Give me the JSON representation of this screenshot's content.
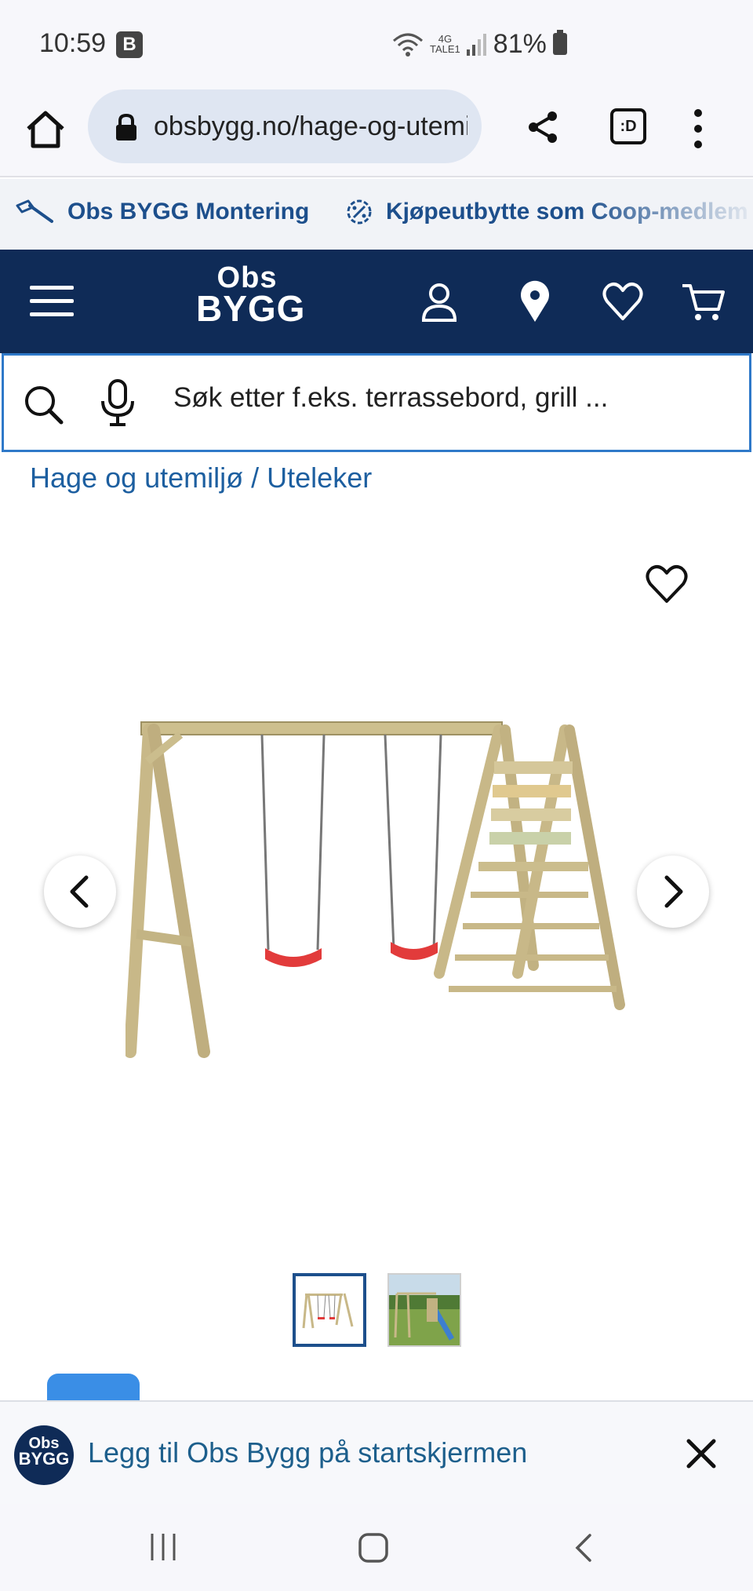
{
  "status_bar": {
    "time": "10:59",
    "badge": "B",
    "network_top": "4G",
    "network_bottom": "TALE1",
    "battery": "81%"
  },
  "browser": {
    "url": "obsbygg.no/hage-og-utemiljo/uteleker"
  },
  "promo_strip": {
    "items": [
      {
        "label": "Obs BYGG Montering",
        "icon": "hammer-icon"
      },
      {
        "label": "Kjøpeutbytte som Coop-medlem",
        "icon": "percent-badge-icon"
      }
    ]
  },
  "header": {
    "logo_top": "Obs",
    "logo_bottom": "BYGG",
    "icons": [
      "menu-icon",
      "account-icon",
      "location-pin-icon",
      "heart-icon",
      "cart-icon"
    ]
  },
  "search": {
    "placeholder": "Søk etter f.eks. terrassebord, grill ..."
  },
  "breadcrumb": {
    "parent": "Hage og utemiljø",
    "separator": " / ",
    "current": "Uteleker"
  },
  "gallery": {
    "image_count": 2,
    "active_index": 1
  },
  "install_banner": {
    "logo_top": "Obs",
    "logo_bottom": "BYGG",
    "text": "Legg til Obs Bygg på startskjermen"
  },
  "colors": {
    "brand_navy": "#0f2b57",
    "link_blue": "#1d5fa0",
    "search_border": "#2f79c9",
    "swing_seat_red": "#e23b3b"
  }
}
